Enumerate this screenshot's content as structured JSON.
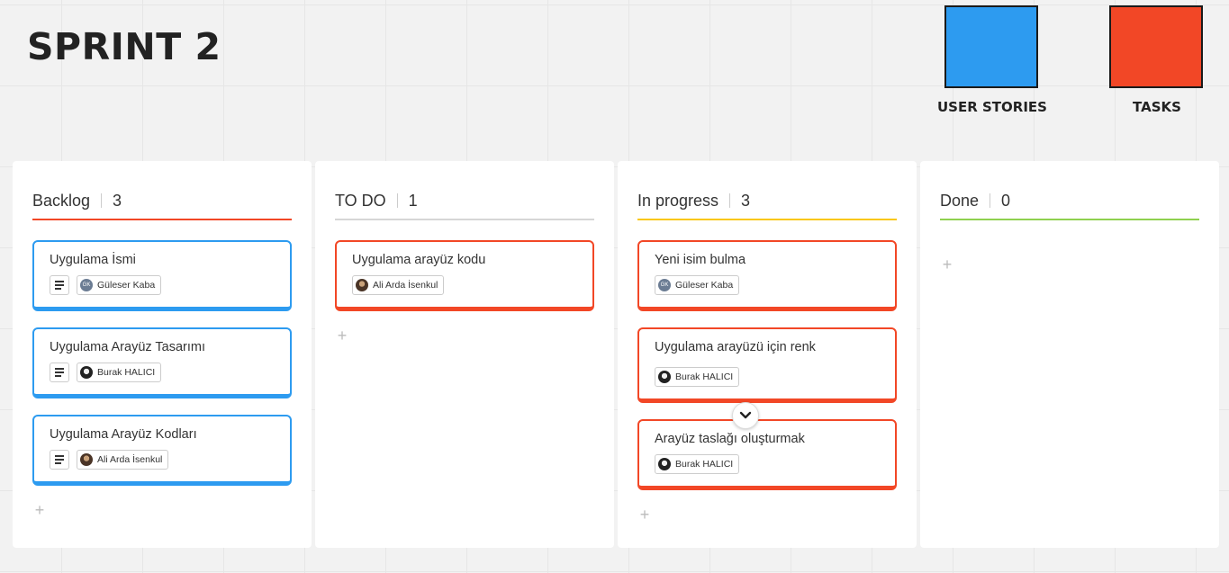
{
  "board": {
    "title": "SPRINT 2"
  },
  "legend": [
    {
      "label": "USER STORIES",
      "color": "#2d9bf0"
    },
    {
      "label": "TASKS",
      "color": "#f24726"
    }
  ],
  "columns": [
    {
      "name": "Backlog",
      "count": "3",
      "line_color": "#f24726",
      "cards": [
        {
          "title": "Uygulama İsmi",
          "type": "story",
          "has_description": true,
          "assignee": "Güleser Kaba",
          "avatar": "gk",
          "avatar_initials": "GK"
        },
        {
          "title": "Uygulama Arayüz Tasarımı",
          "type": "story",
          "has_description": true,
          "assignee": "Burak HALICI",
          "avatar": "burak"
        },
        {
          "title": "Uygulama Arayüz Kodları",
          "type": "story",
          "has_description": true,
          "assignee": "Ali Arda İsenkul",
          "avatar": "ali"
        }
      ],
      "add_label": "+"
    },
    {
      "name": "TO DO",
      "count": "1",
      "line_color": "#d6d6d6",
      "cards": [
        {
          "title": "Uygulama arayüz kodu",
          "type": "task",
          "assignee": "Ali Arda İsenkul",
          "avatar": "ali"
        }
      ],
      "add_label": "+"
    },
    {
      "name": "In progress",
      "count": "3",
      "line_color": "#fac710",
      "cards": [
        {
          "title": "Yeni isim bulma",
          "type": "task",
          "assignee": "Güleser Kaba",
          "avatar": "gk",
          "avatar_initials": "GK"
        },
        {
          "title": "Uygulama arayüzü için renk",
          "type": "task",
          "assignee": "Burak HALICI",
          "avatar": "burak"
        },
        {
          "title": "Arayüz taslağı oluşturmak",
          "type": "task",
          "assignee": "Burak HALICI",
          "avatar": "burak"
        }
      ],
      "add_label": "+"
    },
    {
      "name": "Done",
      "count": "0",
      "line_color": "#8fd14f",
      "cards": [],
      "add_label": "+"
    }
  ],
  "icons": {
    "description": "description-icon",
    "expand": "chevron-down-icon",
    "add": "plus-icon"
  }
}
